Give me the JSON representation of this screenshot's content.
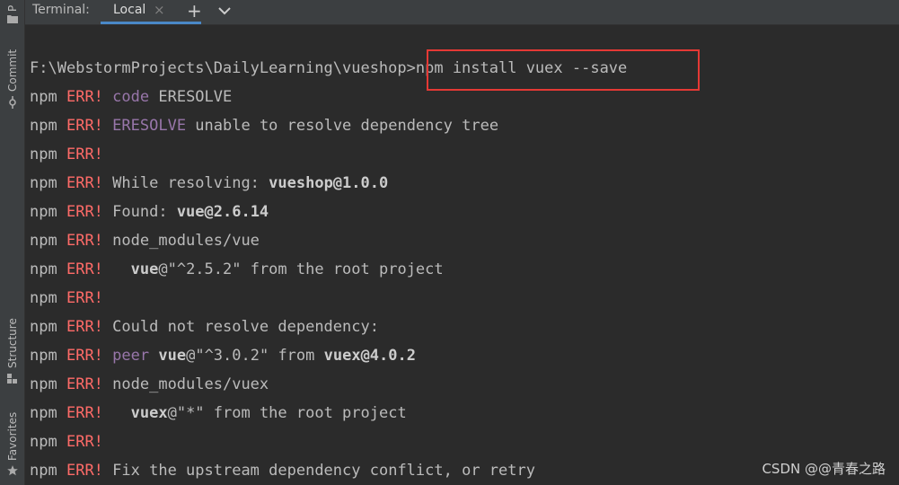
{
  "tool_strip": {
    "project_label": "P",
    "commit_label": "Commit",
    "structure_label": "Structure",
    "favorites_label": "Favorites"
  },
  "tabbar": {
    "title": "Terminal:",
    "tab_local_label": "Local",
    "close_glyph": "×",
    "add_glyph": "+"
  },
  "terminal": {
    "prompt_path": "F:\\WebstormProjects\\DailyLearning\\vueshop>",
    "command": "npm install vuex --save",
    "lines": [
      {
        "npm": "npm",
        "err": "ERR!",
        "kw": "code",
        "text": " ERESOLVE",
        "bold": ""
      },
      {
        "npm": "npm",
        "err": "ERR!",
        "kw": "ERESOLVE",
        "text": " unable to resolve dependency tree",
        "bold": ""
      },
      {
        "npm": "npm",
        "err": "ERR!",
        "kw": "",
        "text": "",
        "bold": ""
      },
      {
        "npm": "npm",
        "err": "ERR!",
        "kw": "",
        "text": " While resolving: ",
        "bold": "vueshop@1.0.0"
      },
      {
        "npm": "npm",
        "err": "ERR!",
        "kw": "",
        "text": " Found: ",
        "bold": "vue@2.6.14"
      },
      {
        "npm": "npm",
        "err": "ERR!",
        "kw": "",
        "text": " node_modules/vue",
        "bold": ""
      },
      {
        "npm": "npm",
        "err": "ERR!",
        "kw": "",
        "text": "   ",
        "bold": "vue",
        "tail": "@\"^2.5.2\" from the root project"
      },
      {
        "npm": "npm",
        "err": "ERR!",
        "kw": "",
        "text": "",
        "bold": ""
      },
      {
        "npm": "npm",
        "err": "ERR!",
        "kw": "",
        "text": " Could not resolve dependency:",
        "bold": ""
      },
      {
        "npm": "npm",
        "err": "ERR!",
        "kw": "peer",
        "text": " ",
        "bold": "vue",
        "tail": "@\"^3.0.2\" from ",
        "bold2": "vuex@4.0.2"
      },
      {
        "npm": "npm",
        "err": "ERR!",
        "kw": "",
        "text": " node_modules/vuex",
        "bold": ""
      },
      {
        "npm": "npm",
        "err": "ERR!",
        "kw": "",
        "text": "   ",
        "bold": "vuex",
        "tail": "@\"*\" from the root project"
      },
      {
        "npm": "npm",
        "err": "ERR!",
        "kw": "",
        "text": "",
        "bold": ""
      },
      {
        "npm": "npm",
        "err": "ERR!",
        "kw": "",
        "text": " Fix the upstream dependency conflict, or retry",
        "bold": ""
      }
    ]
  },
  "watermark": "CSDN @@青春之路",
  "colors": {
    "background": "#2b2b2b",
    "error": "#ff6b68",
    "keyword": "#9876aa",
    "highlight_box": "#e53935",
    "tab_underline": "#4a88c7"
  },
  "icons": [
    "folder-icon",
    "commit-icon",
    "structure-icon",
    "star-icon",
    "close-icon",
    "plus-icon",
    "chevron-down-icon"
  ]
}
